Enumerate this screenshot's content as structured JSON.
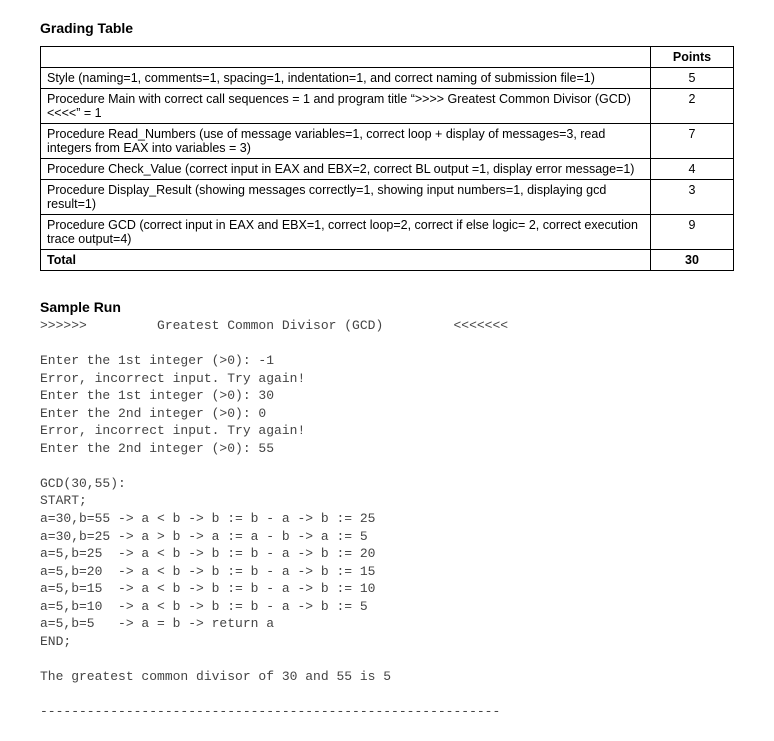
{
  "grading": {
    "title": "Grading Table",
    "points_header": "Points",
    "rows": [
      {
        "desc": "Style (naming=1, comments=1, spacing=1, indentation=1, and correct naming of submission file=1)",
        "points": "5"
      },
      {
        "desc": "Procedure Main with correct call sequences = 1 and program title “>>>>  Greatest Common Divisor (GCD) <<<<” = 1",
        "points": "2"
      },
      {
        "desc": "Procedure Read_Numbers (use of message variables=1, correct loop + display of messages=3, read integers from EAX into variables = 3)",
        "points": "7"
      },
      {
        "desc": "Procedure Check_Value (correct input in EAX and EBX=2, correct BL output =1, display error message=1)",
        "points": "4"
      },
      {
        "desc": "Procedure Display_Result (showing messages correctly=1, showing input numbers=1, displaying gcd result=1)",
        "points": "3"
      },
      {
        "desc": "Procedure GCD (correct input in EAX and EBX=1, correct loop=2, correct if else logic= 2, correct execution trace output=4)",
        "points": "9"
      }
    ],
    "total_label": "Total",
    "total_points": "30"
  },
  "sample": {
    "title": "Sample Run",
    "lines": [
      ">>>>>>         Greatest Common Divisor (GCD)         <<<<<<<",
      "",
      "Enter the 1st integer (>0): -1",
      "Error, incorrect input. Try again!",
      "Enter the 1st integer (>0): 30",
      "Enter the 2nd integer (>0): 0",
      "Error, incorrect input. Try again!",
      "Enter the 2nd integer (>0): 55",
      "",
      "GCD(30,55):",
      "START;",
      "a=30,b=55 -> a < b -> b := b - a -> b := 25",
      "a=30,b=25 -> a > b -> a := a - b -> a := 5",
      "a=5,b=25  -> a < b -> b := b - a -> b := 20",
      "a=5,b=20  -> a < b -> b := b - a -> b := 15",
      "a=5,b=15  -> a < b -> b := b - a -> b := 10",
      "a=5,b=10  -> a < b -> b := b - a -> b := 5",
      "a=5,b=5   -> a = b -> return a",
      "END;",
      "",
      "The greatest common divisor of 30 and 55 is 5",
      "",
      "-----------------------------------------------------------"
    ]
  }
}
